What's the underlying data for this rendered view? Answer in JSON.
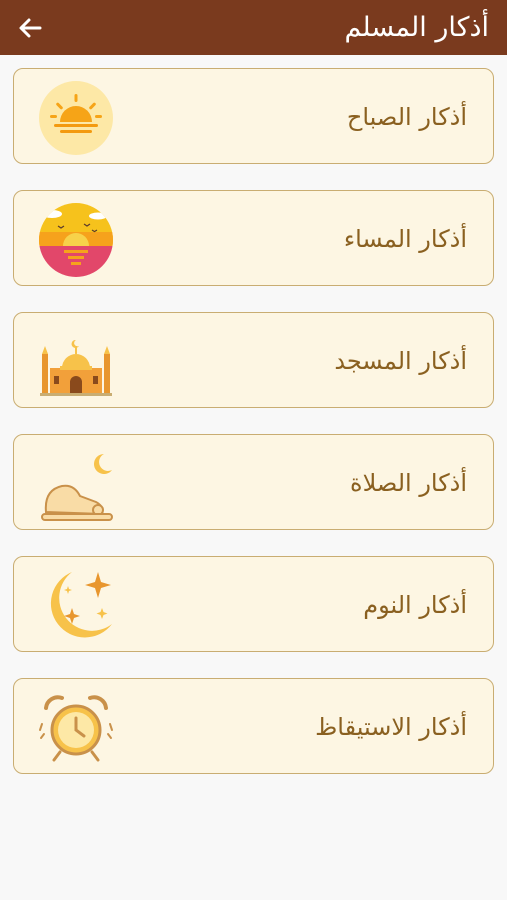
{
  "header": {
    "title": "أذكار المسلم",
    "back_icon": "arrow-left-icon",
    "background": "#7a3a1e"
  },
  "colors": {
    "card_background": "#fdf6e3",
    "card_border": "#c9ad72",
    "label_text": "#8a6020",
    "page_background": "#f8f8f8"
  },
  "items": [
    {
      "label": "أذكار الصباح",
      "icon": "sunrise-icon"
    },
    {
      "label": "أذكار المساء",
      "icon": "sunset-icon"
    },
    {
      "label": "أذكار المسجد",
      "icon": "mosque-icon"
    },
    {
      "label": "أذكار الصلاة",
      "icon": "praying-person-icon"
    },
    {
      "label": "أذكار النوم",
      "icon": "crescent-moon-stars-icon"
    },
    {
      "label": "أذكار الاستيقاظ",
      "icon": "alarm-clock-icon"
    }
  ]
}
